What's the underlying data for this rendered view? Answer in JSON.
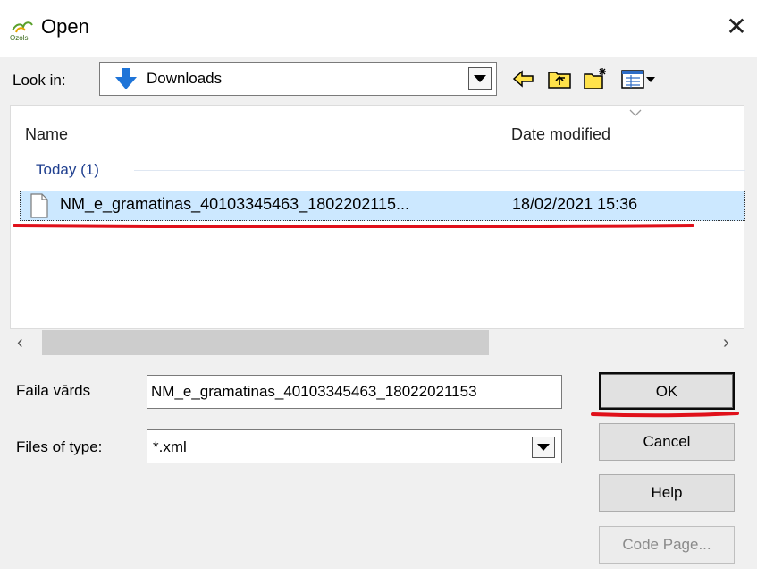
{
  "window": {
    "title": "Open",
    "app_logo_text": "Ozols",
    "close_glyph": "✕"
  },
  "lookin": {
    "label": "Look in:",
    "value": "Downloads"
  },
  "toolbar": {
    "icons": [
      "back-icon",
      "up-folder-icon",
      "new-folder-icon",
      "view-menu-icon"
    ]
  },
  "filelist": {
    "columns": [
      "Name",
      "Date modified"
    ],
    "group": "Today (1)",
    "rows": [
      {
        "name": "NM_e_gramatinas_40103345463_1802202115...",
        "date": "18/02/2021 15:36"
      }
    ]
  },
  "filename": {
    "label": "Faila vārds",
    "value": "NM_e_gramatinas_40103345463_18022021153"
  },
  "filetype": {
    "label": "Files of type:",
    "value": "*.xml"
  },
  "buttons": {
    "ok": "OK",
    "cancel": "Cancel",
    "help": "Help",
    "codepage": "Code Page..."
  },
  "colors": {
    "annotation": "#e0101a",
    "selection": "#cce8ff"
  }
}
